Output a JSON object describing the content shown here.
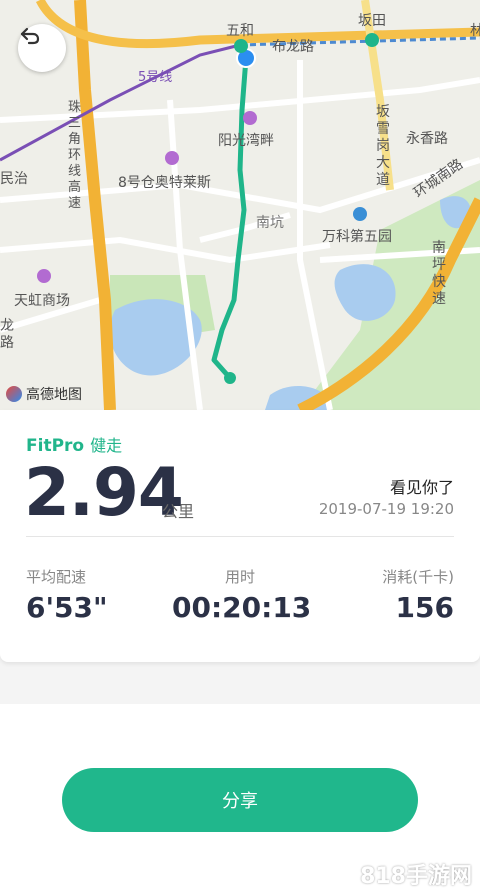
{
  "map": {
    "labels": {
      "wuhe": "五和",
      "bantian": "坂田",
      "bulong_road": "布龙路",
      "line5": "5号线",
      "yangguang": "阳光湾畔",
      "zhusanjiao": "珠三角环线高速",
      "outlets": "8号仓奥特莱斯",
      "bantian_road": "坂雪岗大道",
      "yongxiang": "永香路",
      "nankeng": "南坑",
      "vanke": "万科第五园",
      "huancheng": "环城南路",
      "tianhong": "天虹商场",
      "minzhi": "民治",
      "nanping": "南坪快速",
      "long_road": "龙路",
      "lin": "林"
    },
    "logo_text": "高德地图"
  },
  "back_button": {
    "icon": "back-arrow-icon"
  },
  "workout": {
    "brand": "FitPro",
    "type": "健走",
    "distance": "2.94",
    "unit": "公里",
    "motto": "看见你了",
    "datetime": "2019-07-19 19:20",
    "stats": [
      {
        "label": "平均配速",
        "value": "6'53\""
      },
      {
        "label": "用时",
        "value": "00:20:13"
      },
      {
        "label": "消耗(千卡)",
        "value": "156"
      }
    ]
  },
  "share_label": "分享",
  "watermark": "818手游网",
  "colors": {
    "accent": "#20b78c",
    "route": "#1fb58a",
    "text_dark": "#2b3146"
  }
}
